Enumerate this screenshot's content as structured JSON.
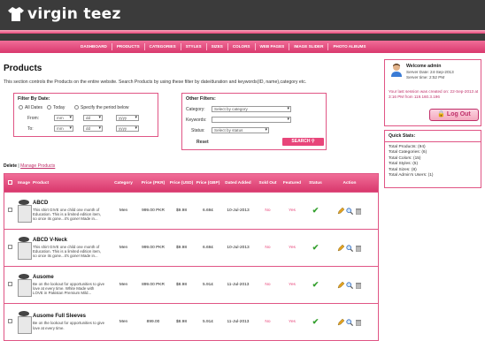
{
  "brand": {
    "name": "virgin teez"
  },
  "nav": [
    "DASHBOARD",
    "PRODUCTS",
    "CATEGORIES",
    "STYLES",
    "SIZES",
    "COLORS",
    "WEB PAGES",
    "IMAGE SLIDER",
    "PHOTO ALBUMS"
  ],
  "page": {
    "title": "Products",
    "description": "This section controls the Products on the entire website. Search Products by using these filter by date/duration and keywords(ID, name),category etc."
  },
  "filter_date": {
    "title": "Filter By Date:",
    "all": "All Dates",
    "today": "Today",
    "specify": "Specify the period below",
    "from": "From:",
    "to": "To:",
    "mm": "mm",
    "dd": "dd",
    "yyyy": "yyyy"
  },
  "filter_other": {
    "title": "Other Filters:",
    "category_label": "Category:",
    "category_value": "Select by category",
    "keywords_label": "Keywords:",
    "status_label": "Status:",
    "status_value": "Select by status",
    "reset": "Reset",
    "search": "SEARCH"
  },
  "actions": {
    "delete": "Delete",
    "sep": "|",
    "manage": "Manage Products"
  },
  "welcome": {
    "title": "Welcome admin",
    "server_date": "Server Date: 24-Sep-2013",
    "server_time": "Server time: 2:52 PM",
    "last_session": "Your last session was created on: 22-Sep-2013 at 3:16 PM from 119.160.3.196",
    "logout": "Log Out"
  },
  "stats": {
    "title": "Quick Stats:",
    "lines": [
      "Total Products: (94)",
      "Total Categories: (6)",
      "Total Colors: (15)",
      "Total Styles: (5)",
      "Total Sizes: (8)",
      "Total Admin's Users: (1)"
    ]
  },
  "table": {
    "headers": [
      "",
      "Image",
      "Product",
      "Category",
      "Price (PKR)",
      "Price (USD)",
      "Price (GBP)",
      "Dated Added",
      "Sold Out",
      "Featured",
      "Status",
      "Action"
    ],
    "rows": [
      {
        "name": "ABCD",
        "desc": "This shirt GIVE one child one month of Education. This is a limited edition item, so once its gone...it's gone! Made in...",
        "category": "Men",
        "pkr": "999.00 PKR",
        "usd": "$9.98",
        "gbp": "6.69£",
        "date": "10-Jul-2013",
        "sold": "No",
        "featured": "Yes"
      },
      {
        "name": "ABCD V-Neck",
        "desc": "This shirt GIVE one child one month of Education. This is a limited edition item, so once its gone...it's gone! Made in...",
        "category": "Men",
        "pkr": "999.00 PKR",
        "usd": "$9.98",
        "gbp": "6.69£",
        "date": "10-Jul-2013",
        "sold": "No",
        "featured": "Yes"
      },
      {
        "name": "Ausome",
        "desc": "Be on the lookout for opportunities to give love at every time. White Made with LOVE in Pakistan Premium Mild...",
        "category": "Men",
        "pkr": "899.00 PKR",
        "usd": "$8.98",
        "gbp": "5.91£",
        "date": "11-Jul-2013",
        "sold": "No",
        "featured": "Yes"
      },
      {
        "name": "Ausome Full Sleeves",
        "desc": "Be on the lookout for opportunities to give love at every time.",
        "category": "Men",
        "pkr": "899.00",
        "usd": "$8.98",
        "gbp": "5.91£",
        "date": "11-Jul-2013",
        "sold": "No",
        "featured": "Yes"
      }
    ]
  }
}
